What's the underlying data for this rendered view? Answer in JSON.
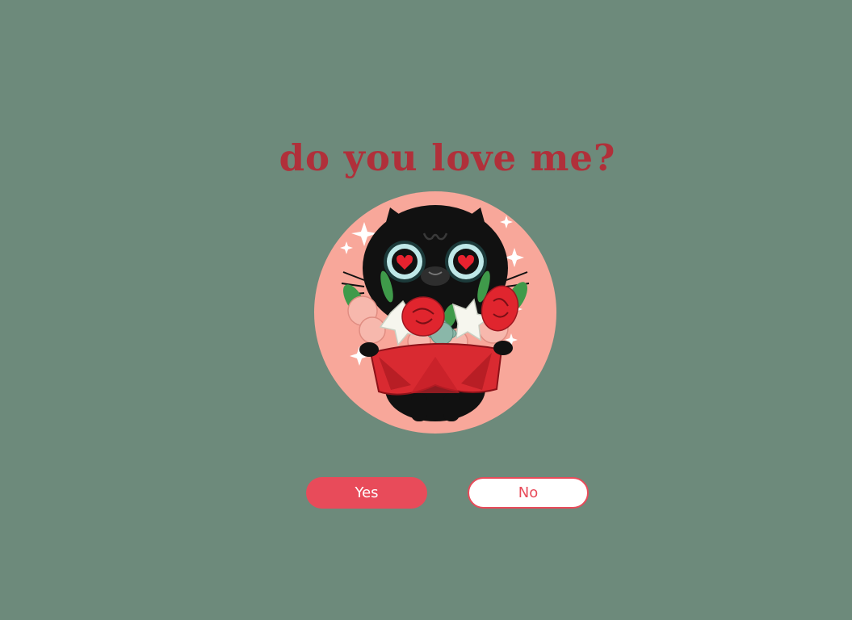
{
  "page": {
    "title": "do you love me?",
    "background_color": "#6d8a7b",
    "title_color": "#b0303a"
  },
  "illustration": {
    "subject": "black cat holding bouquet of flowers",
    "circle_color": "#f8a79a"
  },
  "buttons": {
    "yes_label": "Yes",
    "no_label": "No",
    "accent_color": "#e84b5a"
  }
}
